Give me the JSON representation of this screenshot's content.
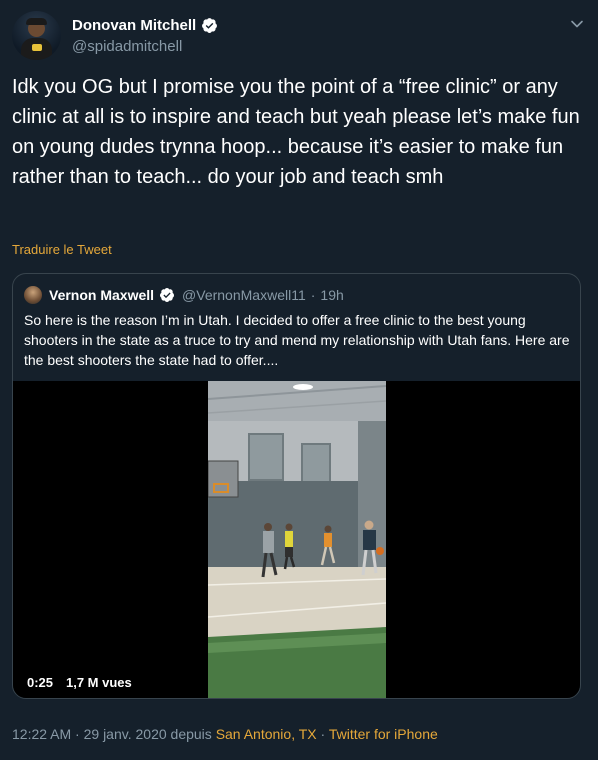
{
  "author": {
    "name": "Donovan Mitchell",
    "handle": "@spidadmitchell"
  },
  "tweet": {
    "text": "Idk you OG but I promise you the point of a “free clinic” or any clinic at all is to inspire and teach but yeah please let’s make fun on young dudes trynna hoop... because it’s easier to make fun rather than to teach... do your job and teach smh",
    "translate_label": "Traduire le Tweet"
  },
  "quoted": {
    "name": "Vernon Maxwell",
    "handle": "@VernonMaxwell11",
    "separator": "·",
    "time": "19h",
    "text": "So here is the reason I’m in Utah. I decided to offer a free clinic to the best young shooters in the state as a truce to try and mend my relationship with Utah fans.  Here are the best shooters the state had to offer....",
    "video": {
      "duration": "0:25",
      "views": "1,7 M vues"
    }
  },
  "meta": {
    "time": "12:22 AM",
    "separator": "·",
    "date": "29 janv. 2020",
    "from_label": "depuis",
    "location": "San Antonio, TX",
    "separator2": "·",
    "client": "Twitter for iPhone"
  },
  "colors": {
    "background": "#15202b",
    "accent": "#e5a83a",
    "muted": "#8899a6",
    "verified": "#ffffff"
  },
  "icons": [
    "verified-badge-icon",
    "chevron-down-icon"
  ]
}
